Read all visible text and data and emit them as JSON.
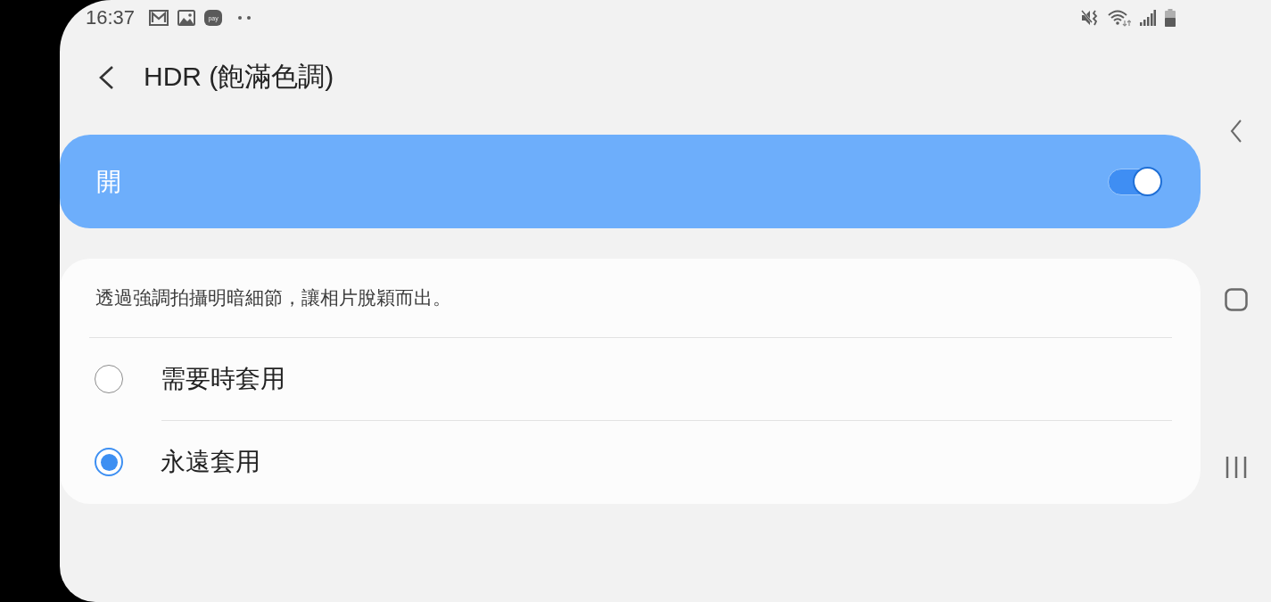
{
  "status_bar": {
    "time": "16:37",
    "app_badge": "pay"
  },
  "header": {
    "title": "HDR (飽滿色調)"
  },
  "master_switch": {
    "label": "開",
    "on": true
  },
  "options_card": {
    "description": "透過強調拍攝明暗細節，讓相片脫穎而出。",
    "options": [
      {
        "label": "需要時套用",
        "selected": false
      },
      {
        "label": "永遠套用",
        "selected": true
      }
    ]
  }
}
